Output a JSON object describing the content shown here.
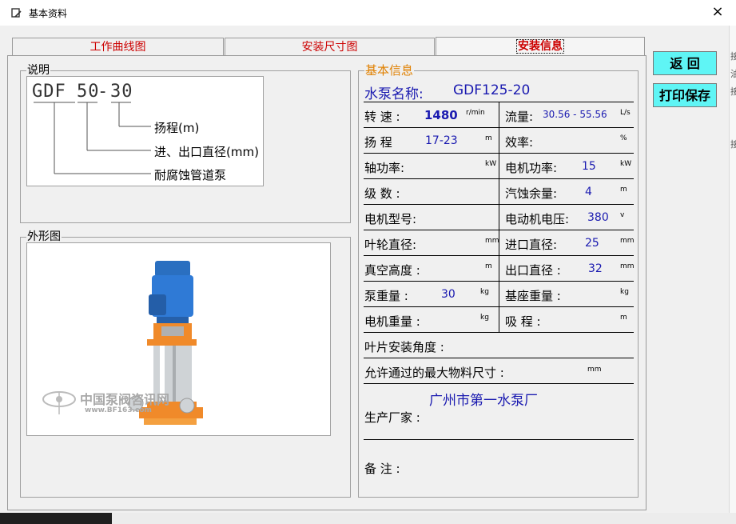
{
  "window": {
    "title": "基本资料",
    "close": "×"
  },
  "tabs": [
    "工作曲线图",
    "安装尺寸图",
    "安装信息"
  ],
  "legend": {
    "group_label": "说明",
    "code_a": "GDF",
    "code_b": "50",
    "code_dash": "-",
    "code_c": "30",
    "line1": "扬程(m)",
    "line2": "进、出口直径(mm)",
    "line3": "耐腐蚀管道泵"
  },
  "outline": {
    "group_label": "外形图",
    "watermark_cn": "中国泵阀咨讯网",
    "watermark_url": "www.BF163.com"
  },
  "info": {
    "group_label": "基本信息",
    "pump_name_label": "水泵名称:",
    "pump_name": "GDF125-20",
    "speed_label": "转 速 :",
    "speed": "1480",
    "speed_unit": "r/min",
    "flow_label": "流量:",
    "flow": "30.56 - 55.56",
    "flow_unit": "L/s",
    "head_label": "扬 程",
    "head": "17-23",
    "head_unit": "m",
    "eff_label": "效率:",
    "eff_unit": "%",
    "shaft_label": "轴功率:",
    "shaft_unit": "kW",
    "motor_power_label": "电机功率:",
    "motor_power": "15",
    "motor_power_unit": "kW",
    "stage_label": "级 数 :",
    "npsh_label": "汽蚀余量:",
    "npsh": "4",
    "npsh_unit": "m",
    "motor_model_label": "电机型号:",
    "voltage_label": "电动机电压:",
    "voltage": "380",
    "voltage_unit": "v",
    "impeller_label": "叶轮直径:",
    "impeller_unit": "mm",
    "inlet_label": "进口直径:",
    "inlet": "25",
    "inlet_unit": "mm",
    "vacuum_label": "真空高度 :",
    "vacuum_unit": "m",
    "outlet_label": "出口直径 :",
    "outlet": "32",
    "outlet_unit": "mm",
    "pump_weight_label": "泵重量 :",
    "pump_weight": "30",
    "pump_weight_unit": "kg",
    "base_weight_label": "基座重量 :",
    "base_weight_unit": "kg",
    "motor_weight_label": "电机重量 :",
    "motor_weight_unit": "kg",
    "suction_label": "吸 程 :",
    "suction_unit": "m",
    "blade_angle_label": "叶片安装角度 :",
    "max_material_label": "允许通过的最大物料尺寸 :",
    "max_material_unit": "mm",
    "maker": "广州市第一水泵厂",
    "maker_label": "生产厂家 :",
    "remark_label": "备 注 :"
  },
  "buttons": {
    "back": "返 回",
    "print_save": "打印保存"
  },
  "right_strip": [
    "接",
    "油",
    "接",
    "接"
  ],
  "colors": {
    "button": "#5ff5f5",
    "tab_text": "#cc0000",
    "value_text": "#1a1ab0",
    "group_label_info": "#e08000"
  }
}
